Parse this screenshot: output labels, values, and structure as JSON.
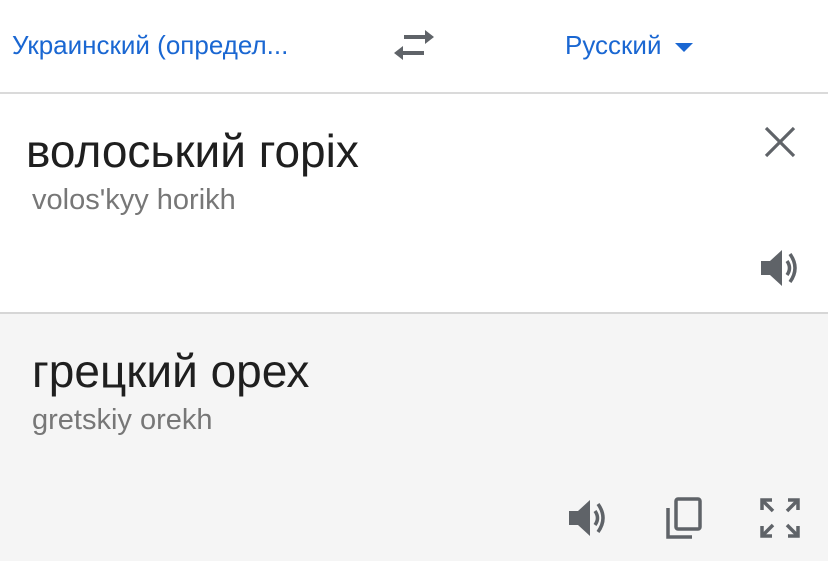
{
  "header": {
    "source_language": "Украинский (определ...",
    "target_language": "Русский",
    "swap_icon": "swap-arrows-icon",
    "dropdown_icon": "caret-down-icon"
  },
  "source": {
    "text": "волоський горіх",
    "transliteration": "volosʹkyy horikh",
    "clear_icon": "close-icon",
    "speak_icon": "speaker-icon"
  },
  "result": {
    "text": "грецкий орех",
    "transliteration": "gretskiy orekh",
    "actions": [
      "speaker-icon",
      "copy-icon",
      "fullscreen-icon"
    ]
  },
  "colors": {
    "accent": "#1a67d2",
    "text": "#1f1f1f",
    "secondary_text": "#777777",
    "icon": "#5f6368",
    "result_background": "#f5f5f5"
  }
}
